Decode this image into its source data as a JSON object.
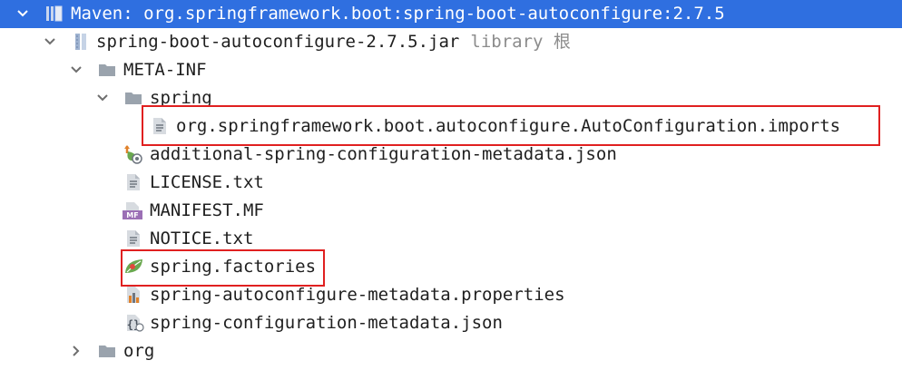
{
  "tree": {
    "root": {
      "label": "Maven: org.springframework.boot:spring-boot-autoconfigure:2.7.5",
      "icon": "library-icon"
    },
    "jar": {
      "label": "spring-boot-autoconfigure-2.7.5.jar",
      "hint": "library 根",
      "icon": "jar-icon"
    },
    "meta_inf": {
      "label": "META-INF",
      "icon": "folder-icon"
    },
    "spring_folder": {
      "label": "spring",
      "icon": "folder-icon"
    },
    "files": [
      {
        "label": "org.springframework.boot.autoconfigure.AutoConfiguration.imports",
        "icon": "text-file-icon"
      },
      {
        "label": "additional-spring-configuration-metadata.json",
        "icon": "json-config-icon"
      },
      {
        "label": "LICENSE.txt",
        "icon": "text-file-icon"
      },
      {
        "label": "MANIFEST.MF",
        "icon": "manifest-icon"
      },
      {
        "label": "NOTICE.txt",
        "icon": "text-file-icon"
      },
      {
        "label": "spring.factories",
        "icon": "spring-leaf-icon"
      },
      {
        "label": "spring-autoconfigure-metadata.properties",
        "icon": "properties-icon"
      },
      {
        "label": "spring-configuration-metadata.json",
        "icon": "json-file-icon"
      }
    ],
    "org_folder": {
      "label": "org",
      "icon": "folder-icon"
    }
  },
  "colors": {
    "selection": "#2f6fe0",
    "highlight_box": "#e02020",
    "folder": "#9aa3ad"
  }
}
